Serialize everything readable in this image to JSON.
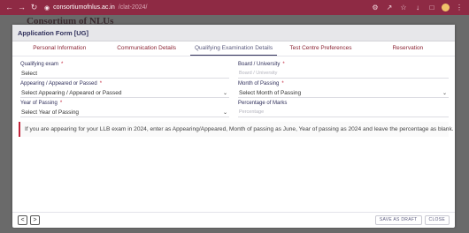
{
  "browser": {
    "url_domain": "consortiumofnlus.ac.in",
    "url_path": "/clat-2024/"
  },
  "site": {
    "title": "Consortium of NLUs",
    "menu_text": ""
  },
  "modal": {
    "title": "Application Form [UG]",
    "tabs": [
      {
        "label": "Personal Information"
      },
      {
        "label": "Communication Details"
      },
      {
        "label": "Qualifying Examination Details"
      },
      {
        "label": "Test Centre Preferences"
      },
      {
        "label": "Reservation"
      }
    ],
    "active_tab": "Qualifying Examination Details",
    "fields": {
      "qualifying_exam": {
        "label": "Qualifying exam",
        "value": "Select"
      },
      "board_university": {
        "label": "Board / University",
        "placeholder": "Board / University"
      },
      "appearing_passed": {
        "label": "Appearing / Appeared or Passed",
        "value": "Select Appearing / Appeared or Passed"
      },
      "month_of_passing": {
        "label": "Month of Passing",
        "value": "Select Month of Passing"
      },
      "year_of_passing": {
        "label": "Year of Passing",
        "value": "Select Year of Passing"
      },
      "percentage": {
        "label": "Percentage of Marks",
        "placeholder": "Percentage"
      }
    },
    "required_mark": "*",
    "note": "If you are appearing for your LLB exam in 2024, enter as Appearing/Appeared, Month of passing as June, Year of passing as 2024 and leave the percentage as blank.",
    "footer": {
      "prev": "<",
      "next": ">",
      "save_draft": "SAVE AS DRAFT",
      "close": "CLOSE"
    }
  },
  "colors": {
    "chrome": "#8e2a44",
    "accent": "#2f2f5a",
    "tab": "#8a2232",
    "required": "#c2243b"
  }
}
